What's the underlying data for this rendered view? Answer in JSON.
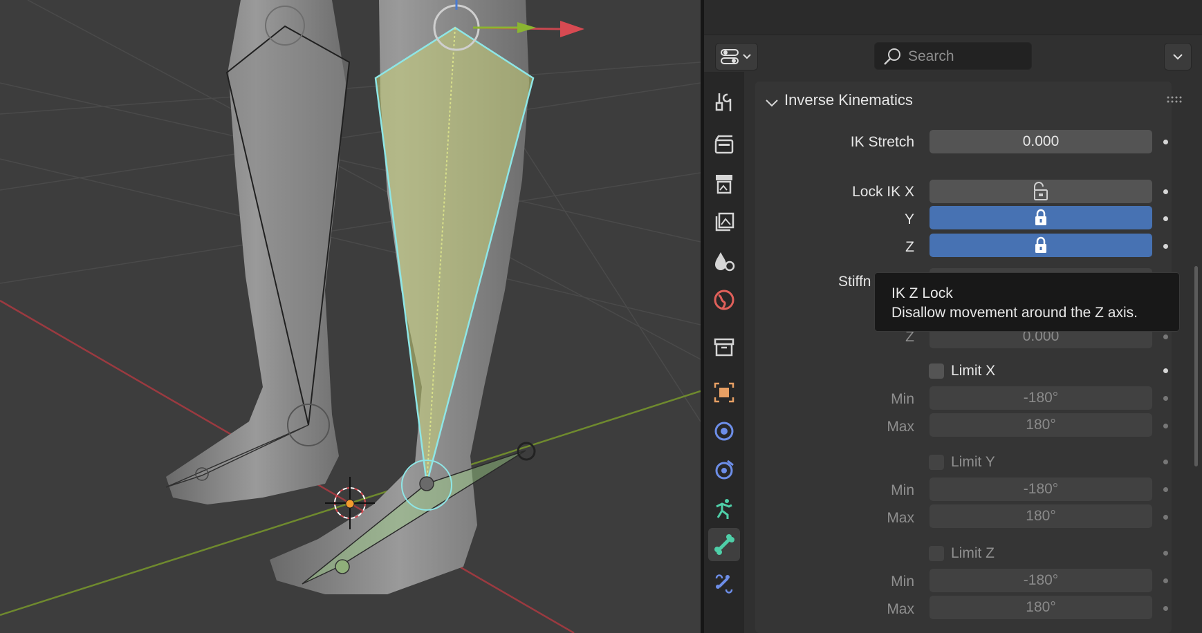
{
  "header": {
    "search": {
      "placeholder": "Search"
    }
  },
  "tabs": [
    {
      "icon": "tool-icon"
    },
    {
      "icon": "render-icon"
    },
    {
      "icon": "output-icon"
    },
    {
      "icon": "view-layer-icon"
    },
    {
      "icon": "scene-icon"
    },
    {
      "icon": "world-icon"
    },
    {
      "icon": "collection-icon"
    },
    {
      "icon": "object-icon"
    },
    {
      "icon": "modifiers-icon"
    },
    {
      "icon": "physics-icon"
    },
    {
      "icon": "object-data-armature-icon"
    },
    {
      "icon": "bone-icon",
      "active": true
    },
    {
      "icon": "bone-constraints-icon"
    }
  ],
  "panel": {
    "title": "Inverse Kinematics",
    "ik_stretch": {
      "label": "IK Stretch",
      "value": "0.000"
    },
    "lock_ik": {
      "x_label": "Lock IK X",
      "y_label": "Y",
      "z_label": "Z",
      "x_locked": false,
      "y_locked": true,
      "z_locked": true
    },
    "stiffness": {
      "label_visible": "Stiffn",
      "z_label": "Z",
      "z_value": "0.000"
    },
    "limit_x": {
      "label": "Limit X",
      "min_label": "Min",
      "min_value": "-180°",
      "max_label": "Max",
      "max_value": "180°"
    },
    "limit_y": {
      "label": "Limit Y",
      "min_label": "Min",
      "min_value": "-180°",
      "max_label": "Max",
      "max_value": "180°"
    },
    "limit_z": {
      "label": "Limit Z",
      "min_label": "Min",
      "min_value": "-180°",
      "max_label": "Max",
      "max_value": "180°"
    }
  },
  "tooltip": {
    "title": "IK Z Lock",
    "description": "Disallow movement around the Z axis."
  },
  "colors": {
    "accent_blue": "#4772b3",
    "active_bone_tint": "#c9d17a",
    "selected_bone_outline": "#8ee6e6",
    "x_axis": "#c8474f",
    "y_axis": "#7a9a32"
  }
}
